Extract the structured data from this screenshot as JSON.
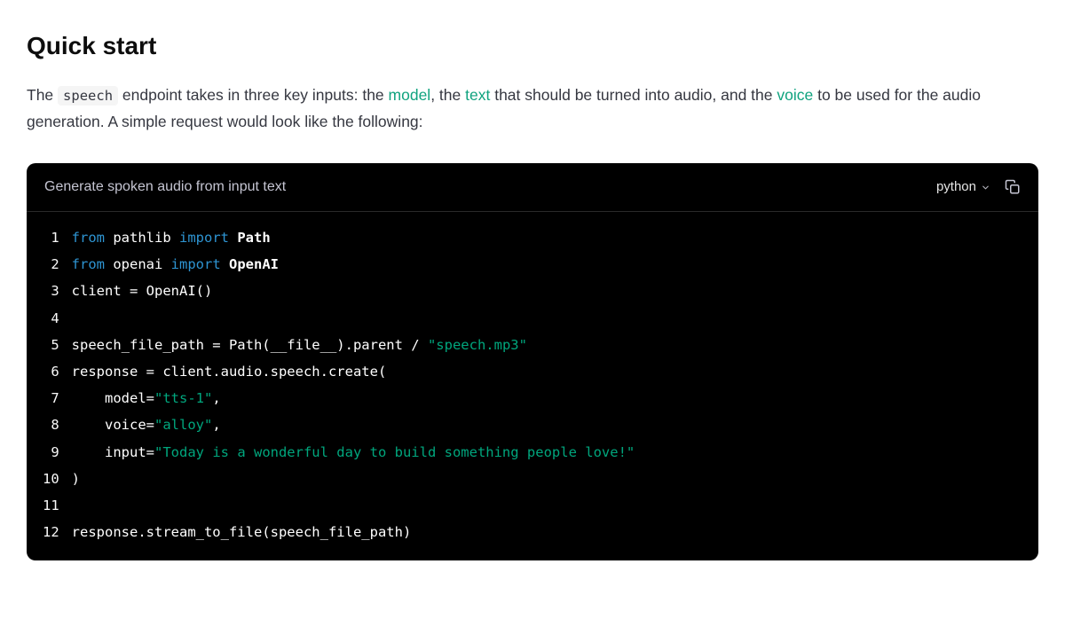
{
  "heading": "Quick start",
  "intro": {
    "pre": "The ",
    "code": "speech",
    "mid1": " endpoint takes in three key inputs: the ",
    "link_model": "model",
    "mid2": ", the ",
    "link_text": "text",
    "mid3": " that should be turned into audio, and the ",
    "link_voice": "voice",
    "post": " to be used for the audio generation. A simple request would look like the following:"
  },
  "code_block": {
    "title": "Generate spoken audio from input text",
    "language": "python",
    "line_numbers": "1\n2\n3\n4\n5\n6\n7\n8\n9\n10\n11\n12",
    "lines": {
      "l1_from": "from",
      "l1_mod": " pathlib ",
      "l1_import": "import",
      "l1_name": " Path",
      "l2_from": "from",
      "l2_mod": " openai ",
      "l2_import": "import",
      "l2_name": " OpenAI",
      "l3": "client = OpenAI()",
      "l4": "",
      "l5_pre": "speech_file_path = Path(__file__).parent / ",
      "l5_str": "\"speech.mp3\"",
      "l6": "response = client.audio.speech.create(",
      "l7_pre": "    model=",
      "l7_str": "\"tts-1\"",
      "l7_post": ",",
      "l8_pre": "    voice=",
      "l8_str": "\"alloy\"",
      "l8_post": ",",
      "l9_pre": "    input=",
      "l9_str": "\"Today is a wonderful day to build something people love!\"",
      "l10": ")",
      "l11": "",
      "l12": "response.stream_to_file(speech_file_path)"
    }
  }
}
